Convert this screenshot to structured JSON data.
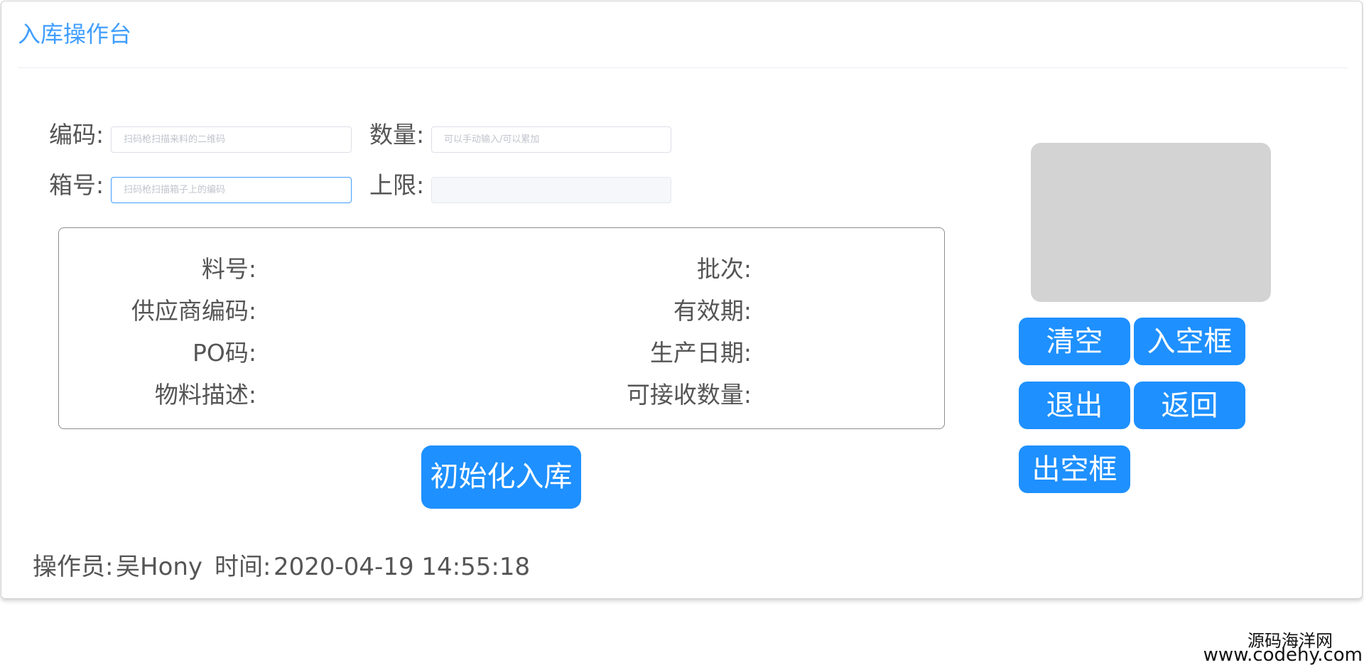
{
  "page": {
    "title": "入库操作台"
  },
  "form": {
    "code_label": "编码:",
    "code_placeholder": "扫码枪扫描来料的二维码",
    "qty_label": "数量:",
    "qty_placeholder": "可以手动输入/可以累加",
    "box_label": "箱号:",
    "box_placeholder": "扫码枪扫描箱子上的编码",
    "limit_label": "上限:",
    "limit_value": ""
  },
  "info": {
    "part_no_label": "料号:",
    "part_no_value": "",
    "supplier_code_label": "供应商编码:",
    "supplier_code_value": "",
    "po_label": "PO码:",
    "po_value": "",
    "description_label": "物料描述:",
    "description_value": "",
    "batch_label": "批次:",
    "batch_value": "",
    "expiry_label": "有效期:",
    "expiry_value": "",
    "mfg_date_label": "生产日期:",
    "mfg_date_value": "",
    "receivable_qty_label": "可接收数量:",
    "receivable_qty_value": ""
  },
  "actions": {
    "init_inbound": "初始化入库",
    "clear": "清空",
    "empty_box_in": "入空框",
    "exit": "退出",
    "back": "返回",
    "empty_box_out": "出空框"
  },
  "footer": {
    "operator_label": "操作员:",
    "operator_name": "吴Hony",
    "time_label": "时间:",
    "time_value": "2020-04-19 14:55:18"
  },
  "watermark": {
    "site_name": "源码海洋网",
    "site_url": "www.codehy.com"
  },
  "colors": {
    "primary": "#1e90ff",
    "title": "#409eff",
    "preview_bg": "#d3d3d3"
  }
}
